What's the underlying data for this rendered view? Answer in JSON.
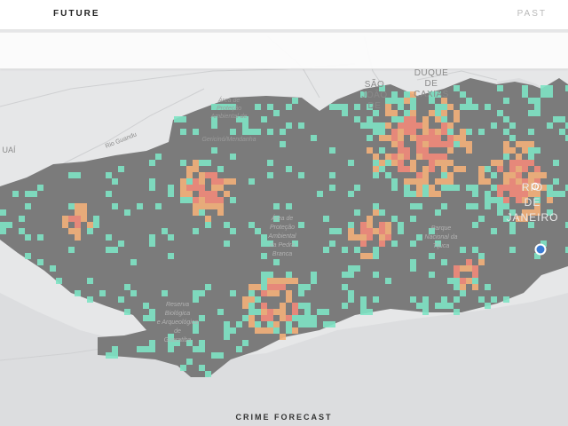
{
  "header": {
    "future_tab": "FUTURE",
    "past_tab": "PAST"
  },
  "footer": {
    "title": "CRIME FORECAST"
  },
  "map": {
    "labels": {
      "sao_joao_1": "SÃO",
      "sao_joao_2": "JOÃO",
      "sao_joao_3": "DE",
      "caxias_1": "DUQUE",
      "caxias_2": "DE",
      "caxias_3": "CAXIAS",
      "rio_guandu": "Rio Guandu",
      "itaguai": "UAÍ",
      "gericino_1": "Área de",
      "gericino_2": "Proteção",
      "gericino_3": "Ambiental de",
      "gericino_4": "Gericinó/Mendanha",
      "pedra_branca_1": "Área de",
      "pedra_branca_2": "Proteção",
      "pedra_branca_3": "Ambiental",
      "pedra_branca_4": "da Pedra",
      "pedra_branca_5": "Branca",
      "tijuca_1": "Parque",
      "tijuca_2": "Nacional da",
      "tijuca_3": "Tijuca",
      "guaratiba_1": "Reserva",
      "guaratiba_2": "Biológica",
      "guaratiba_3": "e Arqueológica",
      "guaratiba_4": "de",
      "guaratiba_5": "Guaratiba",
      "rio_1": "RIO",
      "rio_2": "DE",
      "rio_3": "JANEIRO"
    },
    "colors": {
      "background": "#e6e7e8",
      "sea": "#d9dadc",
      "land_overlay": "#787878",
      "low_risk": "#7ee3c4",
      "mid_risk": "#f3b07a",
      "high_risk": "#f2897a",
      "location_dot": "#3a7bd5"
    }
  }
}
